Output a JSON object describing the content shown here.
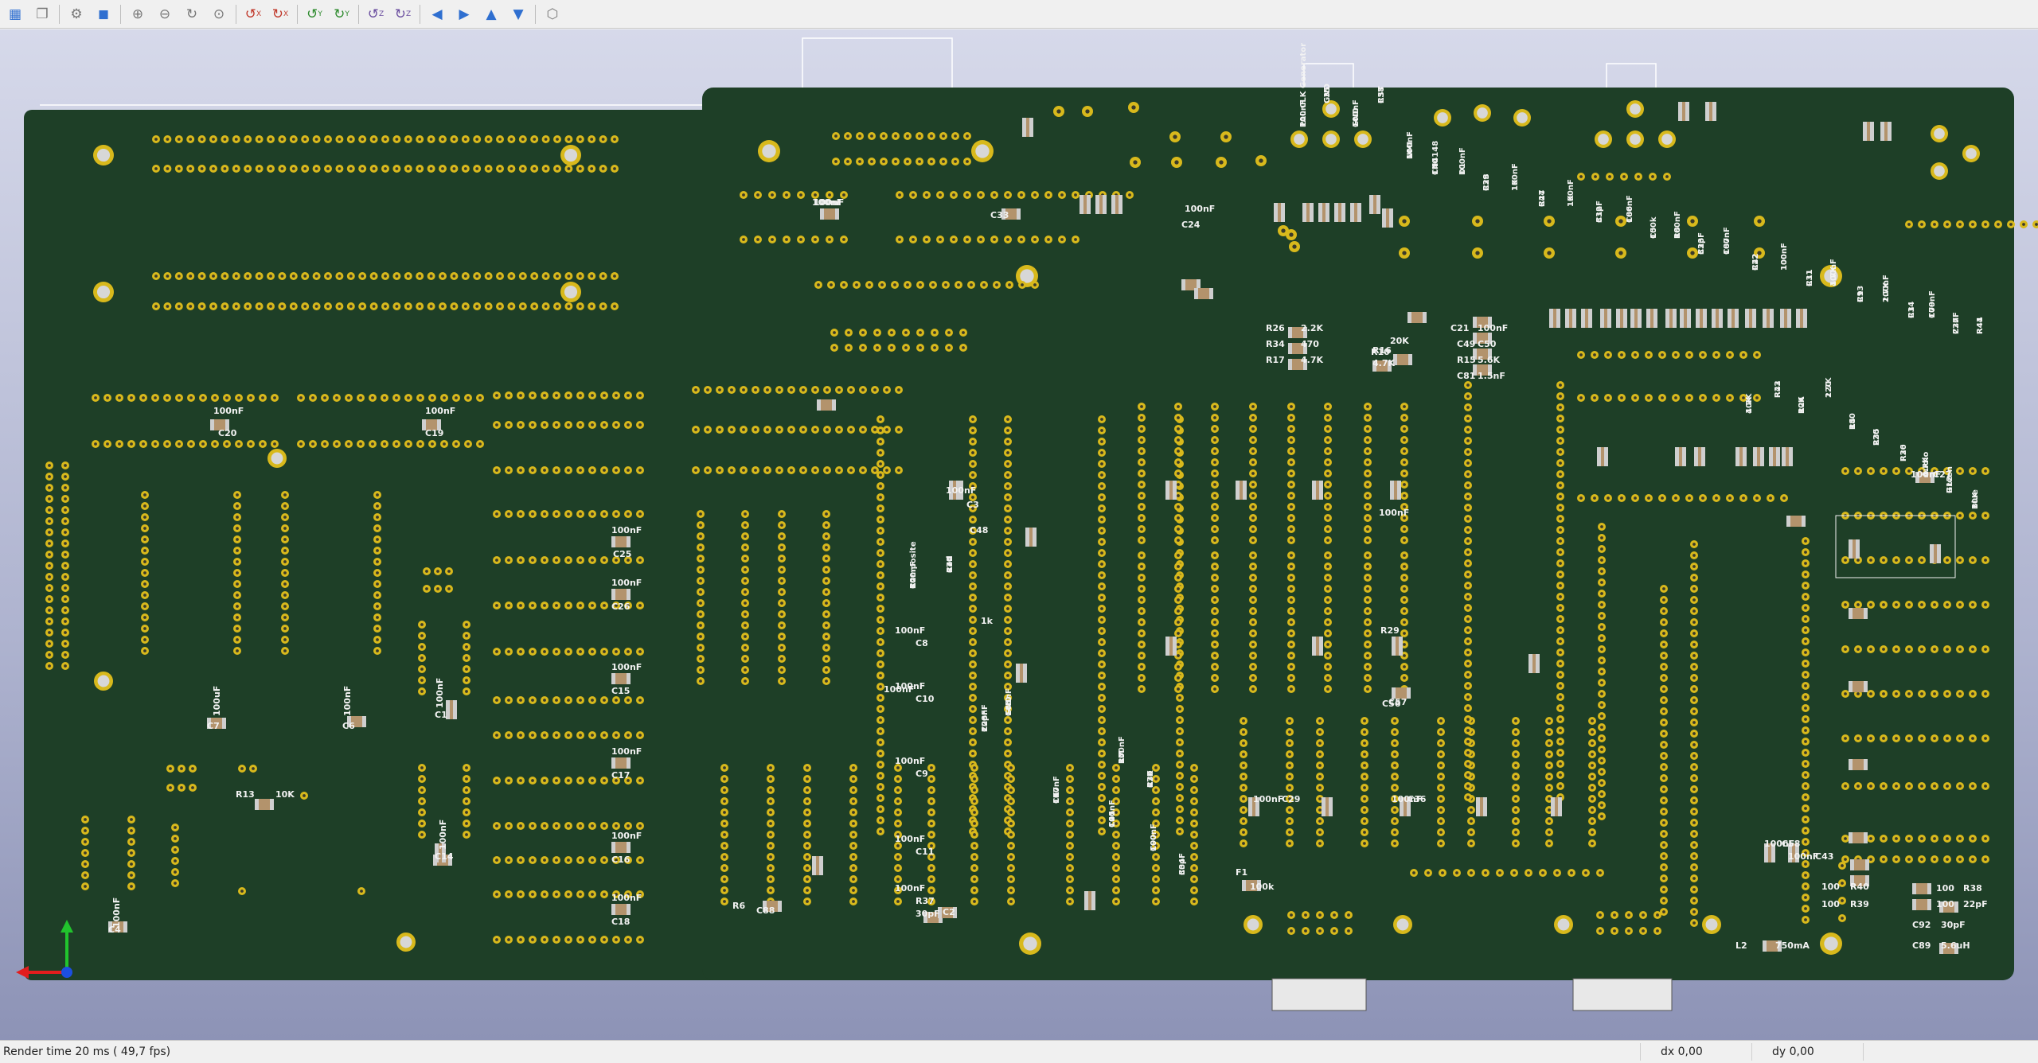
{
  "toolbar": {
    "buttons": [
      {
        "name": "pcbnew-icon",
        "glyph": "▦"
      },
      {
        "name": "copy-image-icon",
        "glyph": "❐"
      },
      {
        "name": "preferences-icon",
        "glyph": "⚙"
      },
      {
        "name": "raytracing-icon",
        "glyph": "◼"
      },
      {
        "name": "zoom-in-icon",
        "glyph": "⊕"
      },
      {
        "name": "zoom-out-icon",
        "glyph": "⊖"
      },
      {
        "name": "redraw-icon",
        "glyph": "↻"
      },
      {
        "name": "zoom-fit-icon",
        "glyph": "⊙"
      },
      {
        "name": "rotate-x-cw-icon",
        "glyph": "↺",
        "label": "X"
      },
      {
        "name": "rotate-x-ccw-icon",
        "glyph": "↻",
        "label": "X"
      },
      {
        "name": "rotate-y-cw-icon",
        "glyph": "↺",
        "label": "Y"
      },
      {
        "name": "rotate-y-ccw-icon",
        "glyph": "↻",
        "label": "Y"
      },
      {
        "name": "rotate-z-cw-icon",
        "glyph": "↺",
        "label": "Z"
      },
      {
        "name": "rotate-z-ccw-icon",
        "glyph": "↻",
        "label": "Z"
      },
      {
        "name": "move-left-icon",
        "glyph": "◀"
      },
      {
        "name": "move-right-icon",
        "glyph": "▶"
      },
      {
        "name": "move-up-icon",
        "glyph": "▲"
      },
      {
        "name": "move-down-icon",
        "glyph": "▼"
      },
      {
        "name": "ortho-view-icon",
        "glyph": "⬡"
      }
    ]
  },
  "colors": {
    "board": "#1e3f27",
    "pad": "#d8b91c",
    "silk": "#f2f2f2",
    "cap_body": "#b3936c",
    "cap_end": "#cfcfcf",
    "background_top": "#d6d9ea",
    "background_bottom": "#8d93b6"
  },
  "labels": {
    "left_board": [
      {
        "t": "100nF"
      },
      {
        "t": "C20"
      },
      {
        "t": "100nF"
      },
      {
        "t": "C19"
      },
      {
        "t": "100nF"
      },
      {
        "t": "C25"
      },
      {
        "t": "100nF"
      },
      {
        "t": "C26"
      },
      {
        "t": "100nF"
      },
      {
        "t": "C15"
      },
      {
        "t": "100nF"
      },
      {
        "t": "C17"
      },
      {
        "t": "100nF"
      },
      {
        "t": "C16"
      },
      {
        "t": "100nF"
      },
      {
        "t": "C18"
      },
      {
        "t": "R13"
      },
      {
        "t": "10K"
      },
      {
        "t": "100uF"
      },
      {
        "t": "C7"
      },
      {
        "t": "100nF"
      },
      {
        "t": "C6"
      },
      {
        "t": "C1"
      },
      {
        "t": "100nF"
      },
      {
        "t": "C14"
      },
      {
        "t": "100nF"
      },
      {
        "t": "C4"
      },
      {
        "t": "100nF"
      }
    ],
    "right_board": [
      {
        "t": "100nF"
      },
      {
        "t": "C33"
      },
      {
        "t": "100nF"
      },
      {
        "t": "C24"
      },
      {
        "t": "100nF"
      },
      {
        "t": "C21"
      },
      {
        "t": "100nF"
      },
      {
        "t": "C49"
      },
      {
        "t": "C50"
      },
      {
        "t": "R15"
      },
      {
        "t": "5.6K"
      },
      {
        "t": "C81"
      },
      {
        "t": "1.5nF"
      },
      {
        "t": "R26"
      },
      {
        "t": "2.2K"
      },
      {
        "t": "R34"
      },
      {
        "t": "470"
      },
      {
        "t": "R17"
      },
      {
        "t": "4.7K"
      },
      {
        "t": "R16"
      },
      {
        "t": "4.7K"
      },
      {
        "t": "R10"
      },
      {
        "t": "20K"
      },
      {
        "t": "100nF"
      },
      {
        "t": "C57"
      },
      {
        "t": "100nF"
      },
      {
        "t": "C48"
      },
      {
        "t": "R29"
      },
      {
        "t": "1k"
      },
      {
        "t": "C56"
      },
      {
        "t": "100nF"
      },
      {
        "t": "C8"
      },
      {
        "t": "100nF"
      },
      {
        "t": "C10"
      },
      {
        "t": "100nF"
      },
      {
        "t": "C9"
      },
      {
        "t": "100nF"
      },
      {
        "t": "C11"
      },
      {
        "t": "100nF"
      },
      {
        "t": "R37"
      },
      {
        "t": "100"
      },
      {
        "t": "R40"
      },
      {
        "t": "100"
      },
      {
        "t": "R39"
      },
      {
        "t": "100"
      },
      {
        "t": "R38"
      },
      {
        "t": "100"
      },
      {
        "t": "22pF"
      },
      {
        "t": "C92"
      },
      {
        "t": "30pF"
      },
      {
        "t": "C89"
      },
      {
        "t": "5.6uH"
      },
      {
        "t": "L2"
      },
      {
        "t": "750mA"
      },
      {
        "t": "F1"
      },
      {
        "t": "100k"
      },
      {
        "t": "R6"
      },
      {
        "t": "C88"
      },
      {
        "t": "30pF"
      },
      {
        "t": "C2"
      },
      {
        "t": "100nF"
      },
      {
        "t": "C3"
      },
      {
        "t": "100nF"
      },
      {
        "t": "C58"
      },
      {
        "t": "100nF"
      },
      {
        "t": "C43"
      },
      {
        "t": "100nF"
      },
      {
        "t": "C27"
      },
      {
        "t": "100nF"
      },
      {
        "t": "C29"
      },
      {
        "t": "100nF"
      },
      {
        "t": "C36"
      },
      {
        "t": "100nF"
      },
      {
        "t": "C32"
      },
      {
        "t": "100nF"
      },
      {
        "t": "C28"
      },
      {
        "t": "100nF"
      },
      {
        "t": "C30"
      },
      {
        "t": "100nF"
      },
      {
        "t": "C45"
      },
      {
        "t": "100nF"
      },
      {
        "t": "C34"
      },
      {
        "t": "100nF"
      },
      {
        "t": "C35"
      },
      {
        "t": "100nF"
      },
      {
        "t": "C38"
      },
      {
        "t": "100nF"
      },
      {
        "t": "C40"
      },
      {
        "t": "100nF"
      },
      {
        "t": "C39"
      },
      {
        "t": "100nF"
      },
      {
        "t": "C44"
      },
      {
        "t": "100nF"
      },
      {
        "t": "C12"
      },
      {
        "t": "100nF"
      },
      {
        "t": "C5"
      },
      {
        "t": "100nF"
      },
      {
        "t": "C23"
      },
      {
        "t": "100nF"
      },
      {
        "t": "C22"
      },
      {
        "t": "100nF"
      },
      {
        "t": "C31"
      },
      {
        "t": "100nF"
      },
      {
        "t": "C13"
      },
      {
        "t": "100nF"
      },
      {
        "t": "C14"
      },
      {
        "t": "100nF"
      },
      {
        "t": "C37"
      },
      {
        "t": "R44"
      },
      {
        "t": "10K"
      },
      {
        "t": "R43"
      },
      {
        "t": "10K"
      },
      {
        "t": "120"
      },
      {
        "t": "180"
      },
      {
        "t": "R35"
      },
      {
        "t": "R36"
      },
      {
        "t": "Audio"
      },
      {
        "t": "Green"
      },
      {
        "t": "Blue"
      },
      {
        "t": "Composite"
      },
      {
        "t": "Red"
      },
      {
        "t": "GND"
      },
      {
        "t": "22pF"
      },
      {
        "t": "1M"
      },
      {
        "t": "R30"
      },
      {
        "t": "1K"
      },
      {
        "t": "C91"
      },
      {
        "t": "C90"
      },
      {
        "t": "30pF"
      },
      {
        "t": "PAL CLK Generator"
      },
      {
        "t": "GND"
      },
      {
        "t": "GND"
      },
      {
        "t": "RST"
      },
      {
        "t": "NMI"
      },
      {
        "t": "1N4148"
      },
      {
        "t": "D1"
      },
      {
        "t": "R28"
      },
      {
        "t": "1K"
      },
      {
        "t": "R27"
      },
      {
        "t": "1K"
      },
      {
        "t": "33pF"
      },
      {
        "t": "C86"
      },
      {
        "t": "100k"
      },
      {
        "t": "R8"
      },
      {
        "t": "33pF"
      },
      {
        "t": "C87"
      },
      {
        "t": "R42"
      },
      {
        "t": "100"
      },
      {
        "t": "R11"
      },
      {
        "t": "4.7K"
      },
      {
        "t": "R9"
      },
      {
        "t": "2.7K"
      },
      {
        "t": "R3"
      },
      {
        "t": "C79"
      },
      {
        "t": "22nF"
      },
      {
        "t": "R41"
      },
      {
        "t": "4.7K"
      },
      {
        "t": "R22"
      },
      {
        "t": "R24"
      },
      {
        "t": "2.7K"
      },
      {
        "t": "R4"
      },
      {
        "t": "220"
      },
      {
        "t": "R20"
      },
      {
        "t": "4.7K"
      },
      {
        "t": "R12"
      },
      {
        "t": "10K"
      },
      {
        "t": "R2"
      },
      {
        "t": "470"
      },
      {
        "t": "C65"
      },
      {
        "t": "100nF"
      },
      {
        "t": "R7"
      },
      {
        "t": "47K"
      },
      {
        "t": "C47"
      },
      {
        "t": "100nF"
      }
    ]
  },
  "status": {
    "render_time": "Render time 20 ms ( 49,7 fps)",
    "dx": "dx 0,00",
    "dy": "dy 0,00"
  }
}
